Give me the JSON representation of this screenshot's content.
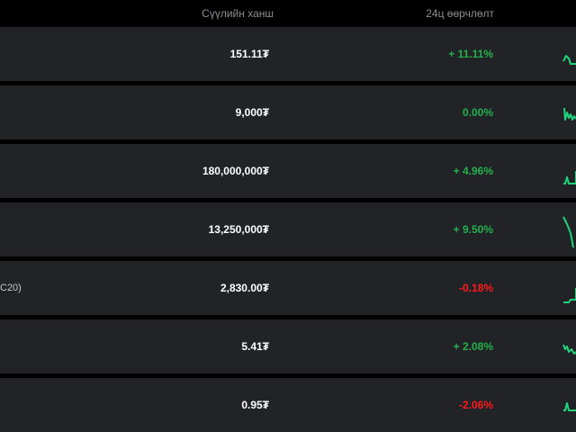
{
  "header": {
    "price_label": "Сүүлийн ханш",
    "change_label": "24ц өөрчлөлт"
  },
  "rows": [
    {
      "name": "",
      "price": "151.11₮",
      "change": "+ 11.11%",
      "direction": "up"
    },
    {
      "name": "",
      "price": "9,000₮",
      "change": "0.00%",
      "direction": "flat"
    },
    {
      "name": "",
      "price": "180,000,000₮",
      "change": "+ 4.96%",
      "direction": "up"
    },
    {
      "name": "",
      "price": "13,250,000₮",
      "change": "+ 9.50%",
      "direction": "up"
    },
    {
      "name": "C20)",
      "price": "2,830.00₮",
      "change": "-0.18%",
      "direction": "down"
    },
    {
      "name": "",
      "price": "5.41₮",
      "change": "+ 2.08%",
      "direction": "up"
    },
    {
      "name": "",
      "price": "0.95₮",
      "change": "-2.06%",
      "direction": "down"
    }
  ],
  "colors": {
    "background": "#000000",
    "row_background": "#222327",
    "positive": "#22b14c",
    "negative": "#ff1a1a",
    "sparkline": "#1fd37a",
    "header_text": "#8a8d93"
  }
}
